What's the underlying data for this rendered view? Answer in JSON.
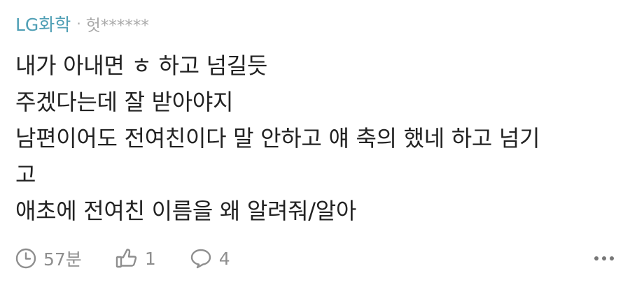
{
  "header": {
    "company": "LG화학",
    "separator": "·",
    "author": "헛******"
  },
  "comment": {
    "lines": [
      "내가 아내면 ㅎ 하고 넘길듯",
      "주겠다는데 잘 받아야지",
      "남편이어도 전여친이다 말 안하고 얘 축의 했네 하고 넘기",
      "고",
      "애초에 전여친 이름을 왜 알려줘/알아"
    ]
  },
  "footer": {
    "time": "57분",
    "likes": "1",
    "replies": "4"
  },
  "icons": {
    "time": "clock-icon",
    "like": "thumbs-up-icon",
    "reply": "speech-bubble-icon",
    "more": "more-horizontal-icon"
  },
  "colors": {
    "company": "#4f9fb5",
    "muted": "#a9a9a9",
    "text": "#222222",
    "meta": "#8e8e8e"
  }
}
